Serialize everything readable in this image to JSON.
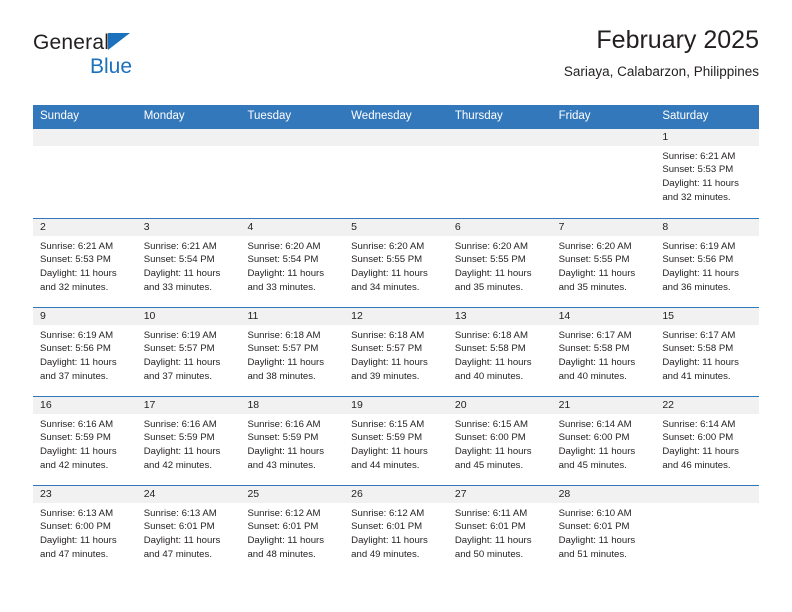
{
  "brand": {
    "name_part1": "General",
    "name_part2": "Blue",
    "triangle_icon": "triangle-icon",
    "accent_color": "#1c71bd"
  },
  "header": {
    "title": "February 2025",
    "subtitle": "Sariaya, Calabarzon, Philippines"
  },
  "calendar": {
    "header_bg": "#3478bc",
    "daynum_bg": "#f1f1f1",
    "weekdays": [
      "Sunday",
      "Monday",
      "Tuesday",
      "Wednesday",
      "Thursday",
      "Friday",
      "Saturday"
    ],
    "weeks": [
      [
        {
          "empty": true
        },
        {
          "empty": true
        },
        {
          "empty": true
        },
        {
          "empty": true
        },
        {
          "empty": true
        },
        {
          "empty": true
        },
        {
          "day": "1",
          "sunrise": "Sunrise: 6:21 AM",
          "sunset": "Sunset: 5:53 PM",
          "daylight1": "Daylight: 11 hours",
          "daylight2": "and 32 minutes."
        }
      ],
      [
        {
          "day": "2",
          "sunrise": "Sunrise: 6:21 AM",
          "sunset": "Sunset: 5:53 PM",
          "daylight1": "Daylight: 11 hours",
          "daylight2": "and 32 minutes."
        },
        {
          "day": "3",
          "sunrise": "Sunrise: 6:21 AM",
          "sunset": "Sunset: 5:54 PM",
          "daylight1": "Daylight: 11 hours",
          "daylight2": "and 33 minutes."
        },
        {
          "day": "4",
          "sunrise": "Sunrise: 6:20 AM",
          "sunset": "Sunset: 5:54 PM",
          "daylight1": "Daylight: 11 hours",
          "daylight2": "and 33 minutes."
        },
        {
          "day": "5",
          "sunrise": "Sunrise: 6:20 AM",
          "sunset": "Sunset: 5:55 PM",
          "daylight1": "Daylight: 11 hours",
          "daylight2": "and 34 minutes."
        },
        {
          "day": "6",
          "sunrise": "Sunrise: 6:20 AM",
          "sunset": "Sunset: 5:55 PM",
          "daylight1": "Daylight: 11 hours",
          "daylight2": "and 35 minutes."
        },
        {
          "day": "7",
          "sunrise": "Sunrise: 6:20 AM",
          "sunset": "Sunset: 5:55 PM",
          "daylight1": "Daylight: 11 hours",
          "daylight2": "and 35 minutes."
        },
        {
          "day": "8",
          "sunrise": "Sunrise: 6:19 AM",
          "sunset": "Sunset: 5:56 PM",
          "daylight1": "Daylight: 11 hours",
          "daylight2": "and 36 minutes."
        }
      ],
      [
        {
          "day": "9",
          "sunrise": "Sunrise: 6:19 AM",
          "sunset": "Sunset: 5:56 PM",
          "daylight1": "Daylight: 11 hours",
          "daylight2": "and 37 minutes."
        },
        {
          "day": "10",
          "sunrise": "Sunrise: 6:19 AM",
          "sunset": "Sunset: 5:57 PM",
          "daylight1": "Daylight: 11 hours",
          "daylight2": "and 37 minutes."
        },
        {
          "day": "11",
          "sunrise": "Sunrise: 6:18 AM",
          "sunset": "Sunset: 5:57 PM",
          "daylight1": "Daylight: 11 hours",
          "daylight2": "and 38 minutes."
        },
        {
          "day": "12",
          "sunrise": "Sunrise: 6:18 AM",
          "sunset": "Sunset: 5:57 PM",
          "daylight1": "Daylight: 11 hours",
          "daylight2": "and 39 minutes."
        },
        {
          "day": "13",
          "sunrise": "Sunrise: 6:18 AM",
          "sunset": "Sunset: 5:58 PM",
          "daylight1": "Daylight: 11 hours",
          "daylight2": "and 40 minutes."
        },
        {
          "day": "14",
          "sunrise": "Sunrise: 6:17 AM",
          "sunset": "Sunset: 5:58 PM",
          "daylight1": "Daylight: 11 hours",
          "daylight2": "and 40 minutes."
        },
        {
          "day": "15",
          "sunrise": "Sunrise: 6:17 AM",
          "sunset": "Sunset: 5:58 PM",
          "daylight1": "Daylight: 11 hours",
          "daylight2": "and 41 minutes."
        }
      ],
      [
        {
          "day": "16",
          "sunrise": "Sunrise: 6:16 AM",
          "sunset": "Sunset: 5:59 PM",
          "daylight1": "Daylight: 11 hours",
          "daylight2": "and 42 minutes."
        },
        {
          "day": "17",
          "sunrise": "Sunrise: 6:16 AM",
          "sunset": "Sunset: 5:59 PM",
          "daylight1": "Daylight: 11 hours",
          "daylight2": "and 42 minutes."
        },
        {
          "day": "18",
          "sunrise": "Sunrise: 6:16 AM",
          "sunset": "Sunset: 5:59 PM",
          "daylight1": "Daylight: 11 hours",
          "daylight2": "and 43 minutes."
        },
        {
          "day": "19",
          "sunrise": "Sunrise: 6:15 AM",
          "sunset": "Sunset: 5:59 PM",
          "daylight1": "Daylight: 11 hours",
          "daylight2": "and 44 minutes."
        },
        {
          "day": "20",
          "sunrise": "Sunrise: 6:15 AM",
          "sunset": "Sunset: 6:00 PM",
          "daylight1": "Daylight: 11 hours",
          "daylight2": "and 45 minutes."
        },
        {
          "day": "21",
          "sunrise": "Sunrise: 6:14 AM",
          "sunset": "Sunset: 6:00 PM",
          "daylight1": "Daylight: 11 hours",
          "daylight2": "and 45 minutes."
        },
        {
          "day": "22",
          "sunrise": "Sunrise: 6:14 AM",
          "sunset": "Sunset: 6:00 PM",
          "daylight1": "Daylight: 11 hours",
          "daylight2": "and 46 minutes."
        }
      ],
      [
        {
          "day": "23",
          "sunrise": "Sunrise: 6:13 AM",
          "sunset": "Sunset: 6:00 PM",
          "daylight1": "Daylight: 11 hours",
          "daylight2": "and 47 minutes."
        },
        {
          "day": "24",
          "sunrise": "Sunrise: 6:13 AM",
          "sunset": "Sunset: 6:01 PM",
          "daylight1": "Daylight: 11 hours",
          "daylight2": "and 47 minutes."
        },
        {
          "day": "25",
          "sunrise": "Sunrise: 6:12 AM",
          "sunset": "Sunset: 6:01 PM",
          "daylight1": "Daylight: 11 hours",
          "daylight2": "and 48 minutes."
        },
        {
          "day": "26",
          "sunrise": "Sunrise: 6:12 AM",
          "sunset": "Sunset: 6:01 PM",
          "daylight1": "Daylight: 11 hours",
          "daylight2": "and 49 minutes."
        },
        {
          "day": "27",
          "sunrise": "Sunrise: 6:11 AM",
          "sunset": "Sunset: 6:01 PM",
          "daylight1": "Daylight: 11 hours",
          "daylight2": "and 50 minutes."
        },
        {
          "day": "28",
          "sunrise": "Sunrise: 6:10 AM",
          "sunset": "Sunset: 6:01 PM",
          "daylight1": "Daylight: 11 hours",
          "daylight2": "and 51 minutes."
        },
        {
          "empty": true
        }
      ]
    ]
  }
}
